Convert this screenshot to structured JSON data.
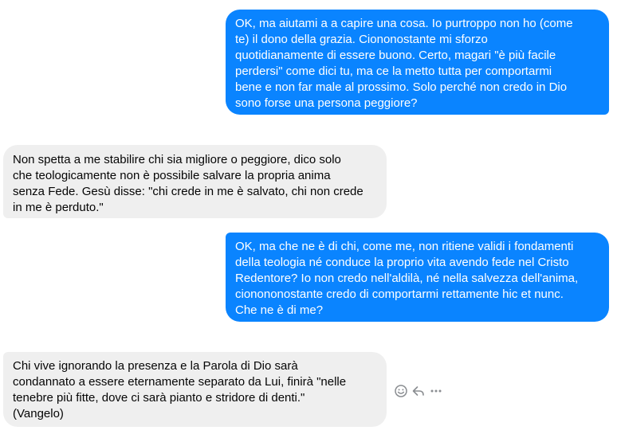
{
  "conversation": {
    "messages": [
      {
        "direction": "outgoing",
        "text": "OK, ma aiutami a a capire una cosa. Io purtroppo non ho (come\nte) il dono della grazia. Ciononostante mi sforzo\nquotidianamente di essere buono. Certo, magari \"è più facile\nperdersi\" come dici tu, ma ce la metto tutta per comportarmi\nbene e non far male al prossimo. Solo perché non credo in Dio\nsono forse una persona peggiore?"
      },
      {
        "direction": "incoming",
        "text": "Non spetta a me stabilire chi sia migliore o peggiore, dico solo\nche teologicamente non è possibile salvare la propria anima\nsenza Fede. Gesù disse: \"chi crede in me è salvato, chi non crede\nin me è perduto.\""
      },
      {
        "direction": "outgoing",
        "text": "OK, ma che ne è di chi, come me, non ritiene validi i fondamenti\ndella teologia né conduce la proprio vita avendo fede nel Cristo\nRedentore? Io non credo nell'aldilà, né nella salvezza dell'anima,\ncionononostante credo di comportarmi rettamente hic et nunc.\nChe ne è di me?"
      },
      {
        "direction": "incoming",
        "text": "Chi vive ignorando la presenza e la Parola di Dio sarà\ncondannato a essere eternamente separato da Lui, finirà \"nelle\ntenebre più fitte, dove ci sarà pianto e stridore di denti.\"\n(Vangelo)"
      }
    ]
  },
  "message_actions": {
    "icons": [
      "smiley-icon",
      "reply-icon",
      "more-options-icon"
    ]
  },
  "colors": {
    "outgoing_bubble": "#0a84ff",
    "incoming_bubble": "#efefef",
    "icon_gray": "#8a8d91"
  }
}
